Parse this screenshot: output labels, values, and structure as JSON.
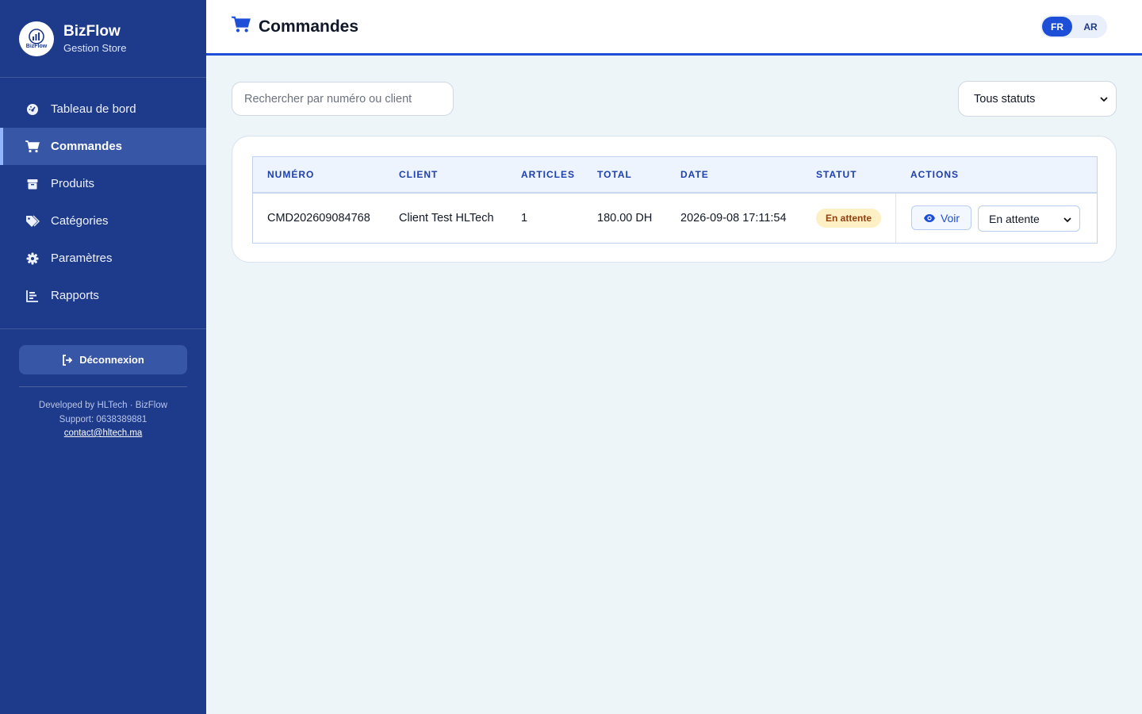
{
  "brand": {
    "name": "BizFlow",
    "subtitle": "Gestion Store",
    "logo_text": "BizFlow"
  },
  "sidebar": {
    "items": [
      {
        "label": "Tableau de bord",
        "icon": "gauge-icon",
        "active": false
      },
      {
        "label": "Commandes",
        "icon": "cart-icon",
        "active": true
      },
      {
        "label": "Produits",
        "icon": "box-icon",
        "active": false
      },
      {
        "label": "Catégories",
        "icon": "tags-icon",
        "active": false
      },
      {
        "label": "Paramètres",
        "icon": "gear-icon",
        "active": false
      },
      {
        "label": "Rapports",
        "icon": "chart-bar-icon",
        "active": false
      }
    ],
    "logout_label": "Déconnexion",
    "footer": {
      "developed_by": "Developed by HLTech · BizFlow",
      "support": "Support: 0638389881",
      "email": "contact@hltech.ma"
    }
  },
  "header": {
    "title": "Commandes",
    "languages": [
      {
        "code": "FR",
        "active": true
      },
      {
        "code": "AR",
        "active": false
      }
    ]
  },
  "filters": {
    "search_placeholder": "Rechercher par numéro ou client",
    "status_selected": "Tous statuts"
  },
  "table": {
    "headers": [
      "NUMÉRO",
      "CLIENT",
      "ARTICLES",
      "TOTAL",
      "DATE",
      "STATUT",
      "ACTIONS"
    ],
    "rows": [
      {
        "number": "CMD202609084768",
        "client": "Client Test HLTech",
        "articles": "1",
        "total": "180.00 DH",
        "date": "2026-09-08 17:11:54",
        "status": "En attente",
        "view_label": "Voir",
        "status_select": "En attente"
      }
    ]
  },
  "colors": {
    "sidebar_bg": "#1e3a8a",
    "accent": "#1d4ed8",
    "page_bg": "#eef5f9",
    "badge_pending_bg": "#fdf0c5"
  }
}
